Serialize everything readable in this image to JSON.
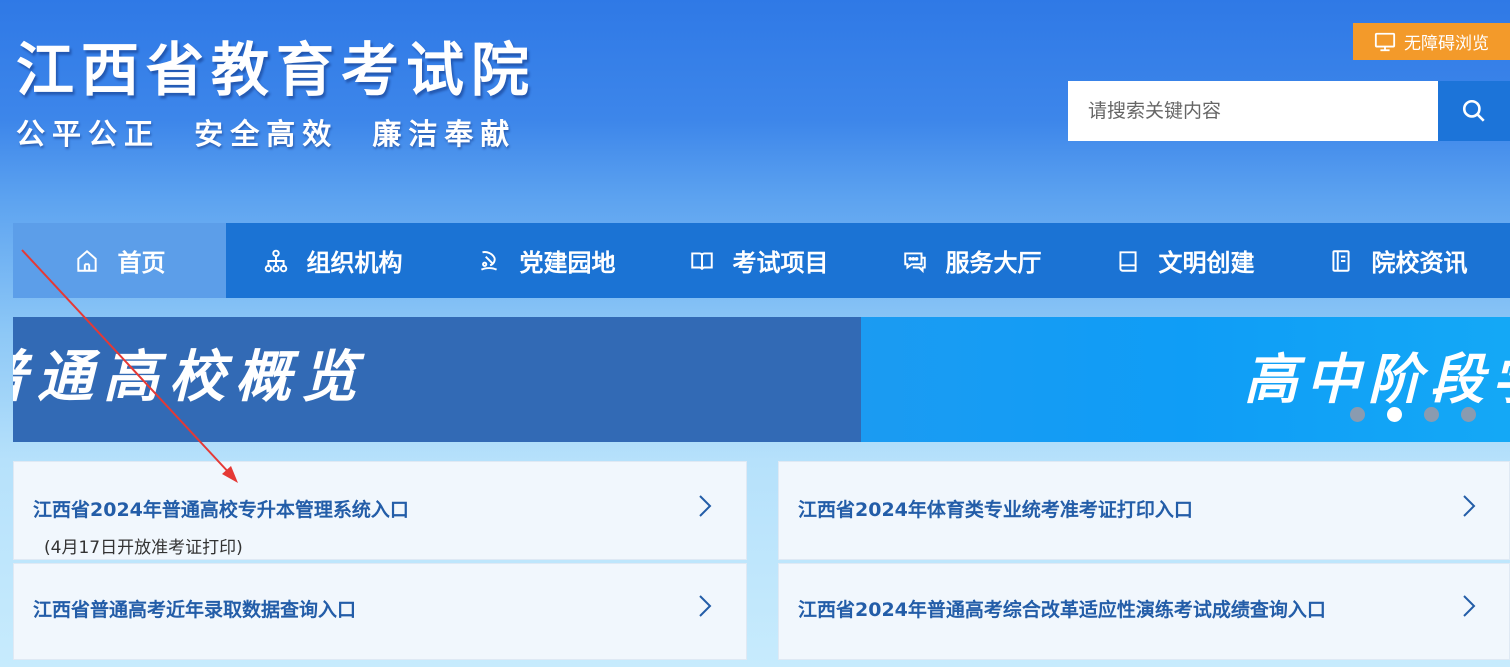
{
  "header": {
    "title": "江西省教育考试院",
    "slogan": "公平公正  安全高效  廉洁奉献",
    "accessibility_label": "无障碍浏览"
  },
  "search": {
    "placeholder": "请搜索关键内容",
    "value": ""
  },
  "nav": {
    "items": [
      {
        "label": "首页",
        "icon": "home-icon",
        "active": true
      },
      {
        "label": "组织机构",
        "icon": "org-chart-icon"
      },
      {
        "label": "党建园地",
        "icon": "party-icon"
      },
      {
        "label": "考试项目",
        "icon": "book-open-icon"
      },
      {
        "label": "服务大厅",
        "icon": "chat-icon"
      },
      {
        "label": "文明创建",
        "icon": "book-icon"
      },
      {
        "label": "院校资讯",
        "icon": "document-icon"
      }
    ]
  },
  "banner": {
    "slides": [
      {
        "text": "普通高校概览"
      },
      {
        "text": "高中阶段学"
      }
    ],
    "dots": 4,
    "active_dot": 1
  },
  "links": [
    {
      "title": "江西省2024年普通高校专升本管理系统入口",
      "subtitle": "(4月17日开放准考证打印)"
    },
    {
      "title": "江西省2024年体育类专业统考准考证打印入口",
      "subtitle": ""
    },
    {
      "title": "江西省普通高考近年录取数据查询入口",
      "subtitle": ""
    },
    {
      "title": "江西省2024年普通高考综合改革适应性演练考试成绩查询入口",
      "subtitle": ""
    }
  ],
  "colors": {
    "nav_bg": "#1b73d4",
    "nav_active": "#5c9ee9",
    "accent_orange": "#f39a2a",
    "link_text": "#235da8",
    "annotation_arrow": "#e53935"
  }
}
